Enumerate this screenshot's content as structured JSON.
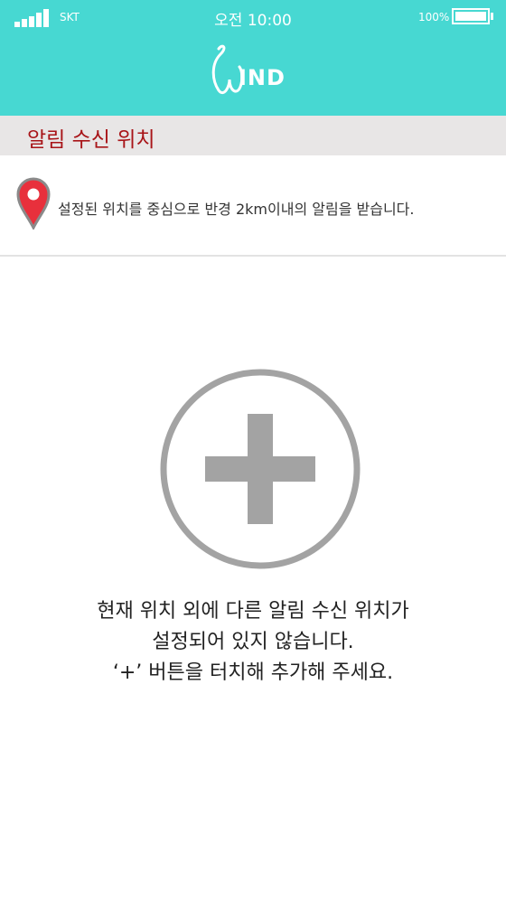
{
  "status_bar": {
    "carrier": "SKT",
    "time": "오전 10:00",
    "battery_percent": "100%",
    "battery_level": 1.0,
    "signal_bars": 5
  },
  "header": {
    "logo_text": "IND",
    "logo_name": "wind-logo",
    "background_color": "#47d8d2"
  },
  "section": {
    "title": "알림 수신 위치",
    "title_color": "#a81418"
  },
  "info": {
    "icon": "location-pin-icon",
    "text": "설정된 위치를 중심으로 반경 2km이내의 알림을 받습니다.",
    "pin_color": "#e8303c"
  },
  "add_button": {
    "icon": "plus-circle-icon",
    "color": "#a3a3a3"
  },
  "empty_message": {
    "line1": "현재 위치 외에 다른 알림 수신 위치가",
    "line2": "설정되어 있지 않습니다.",
    "line3": "‘+’ 버튼을 터치해 추가해 주세요."
  }
}
